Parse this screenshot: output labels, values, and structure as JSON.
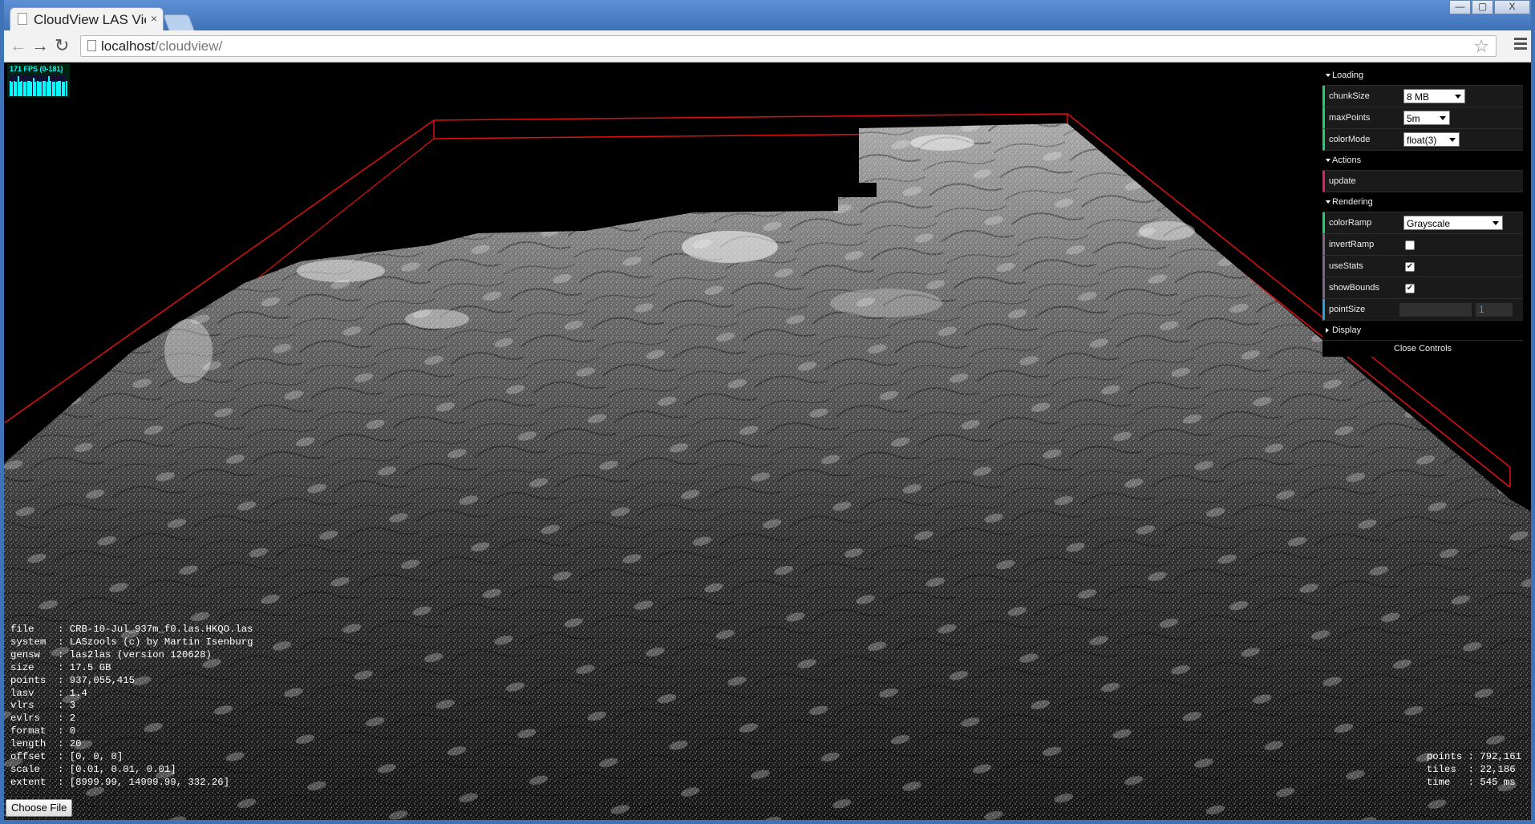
{
  "browser": {
    "tab_title": "CloudView LAS View",
    "tab_close": "×",
    "url_host": "localhost",
    "url_path": "/cloudview/",
    "window_buttons": [
      "—",
      "▢",
      "X"
    ]
  },
  "fps": {
    "label": "171 FPS (0-181)",
    "bars": [
      0.72,
      0.7,
      0.74,
      0.68,
      0.95,
      0.7,
      0.72,
      0.7,
      0.69,
      0.73,
      0.72,
      0.71,
      0.9,
      0.7,
      0.74,
      0.71,
      0.7,
      0.72,
      0.73,
      0.7,
      0.96,
      0.72,
      0.7,
      0.71,
      0.69,
      0.74,
      0.72,
      0.7,
      0.71,
      0.72
    ]
  },
  "controls": {
    "folders": {
      "loading": "Loading",
      "actions": "Actions",
      "rendering": "Rendering",
      "display": "Display"
    },
    "chunkSize": {
      "label": "chunkSize",
      "value": "8 MB"
    },
    "maxPoints": {
      "label": "maxPoints",
      "value": "5m"
    },
    "colorMode": {
      "label": "colorMode",
      "value": "float(3)"
    },
    "update": {
      "label": "update"
    },
    "colorRamp": {
      "label": "colorRamp",
      "value": "Grayscale"
    },
    "invertRamp": {
      "label": "invertRamp",
      "checked": false
    },
    "useStats": {
      "label": "useStats",
      "checked": true
    },
    "showBounds": {
      "label": "showBounds",
      "checked": true
    },
    "pointSize": {
      "label": "pointSize",
      "value": "1"
    },
    "close_label": "Close Controls"
  },
  "info": [
    {
      "key": "file   ",
      "value": "CRB-10-Jul_937m_f0.las.HKQO.las"
    },
    {
      "key": "system ",
      "value": "LASzools (c) by Martin Isenburg"
    },
    {
      "key": "gensw  ",
      "value": "las2las (version 120628)"
    },
    {
      "key": "size   ",
      "value": "17.5 GB"
    },
    {
      "key": "points ",
      "value": "937,055,415"
    },
    {
      "key": "lasv   ",
      "value": "1.4"
    },
    {
      "key": "vlrs   ",
      "value": "3"
    },
    {
      "key": "evlrs  ",
      "value": "2"
    },
    {
      "key": "format ",
      "value": "0"
    },
    {
      "key": "length ",
      "value": "20"
    },
    {
      "key": "offset ",
      "value": "[0, 0, 0]"
    },
    {
      "key": "scale  ",
      "value": "[0.01, 0.01, 0.01]"
    },
    {
      "key": "extent ",
      "value": "[8999.99, 14999.99, 332.26]"
    }
  ],
  "stats": [
    {
      "key": "points",
      "value": "792,161"
    },
    {
      "key": "tiles ",
      "value": "22,186"
    },
    {
      "key": "time  ",
      "value": "545 ms"
    }
  ],
  "choose_file_label": "Choose File",
  "colors": {
    "bounds": "#e01010",
    "gui_number": "#2fa1d6",
    "gui_select": "#1ed36f",
    "gui_function": "#e61d5f",
    "gui_boolean": "#806787",
    "fps_text": "#00ffff"
  }
}
